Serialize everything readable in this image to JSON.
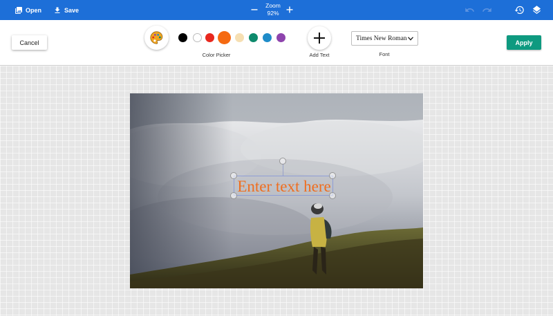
{
  "topbar": {
    "open_label": "Open",
    "save_label": "Save",
    "zoom_label": "Zoom",
    "zoom_value": "92%",
    "icons": [
      "image-icon",
      "download-icon",
      "minus-icon",
      "plus-icon",
      "undo-icon",
      "redo-icon",
      "history-icon",
      "layers-icon"
    ]
  },
  "toolbar": {
    "cancel_label": "Cancel",
    "apply_label": "Apply",
    "color_picker_caption": "Color Picker",
    "add_text_caption": "Add Text",
    "font_caption": "Font",
    "font_value": "Times New Roman",
    "swatches": [
      {
        "color": "#000000",
        "selected": false
      },
      {
        "color": "#ffffff",
        "selected": false
      },
      {
        "color": "#e8281e",
        "selected": false
      },
      {
        "color": "#f56a12",
        "selected": true
      },
      {
        "color": "#f6dfb2",
        "selected": false
      },
      {
        "color": "#0d8a6c",
        "selected": false
      },
      {
        "color": "#1f8cc9",
        "selected": false
      },
      {
        "color": "#8e44ad",
        "selected": false
      }
    ]
  },
  "canvas": {
    "overlay_text": "Enter text here",
    "overlay_text_color": "#ef6d1e"
  },
  "colors": {
    "topbar": "#1d6fd8",
    "apply": "#0e9a80"
  }
}
